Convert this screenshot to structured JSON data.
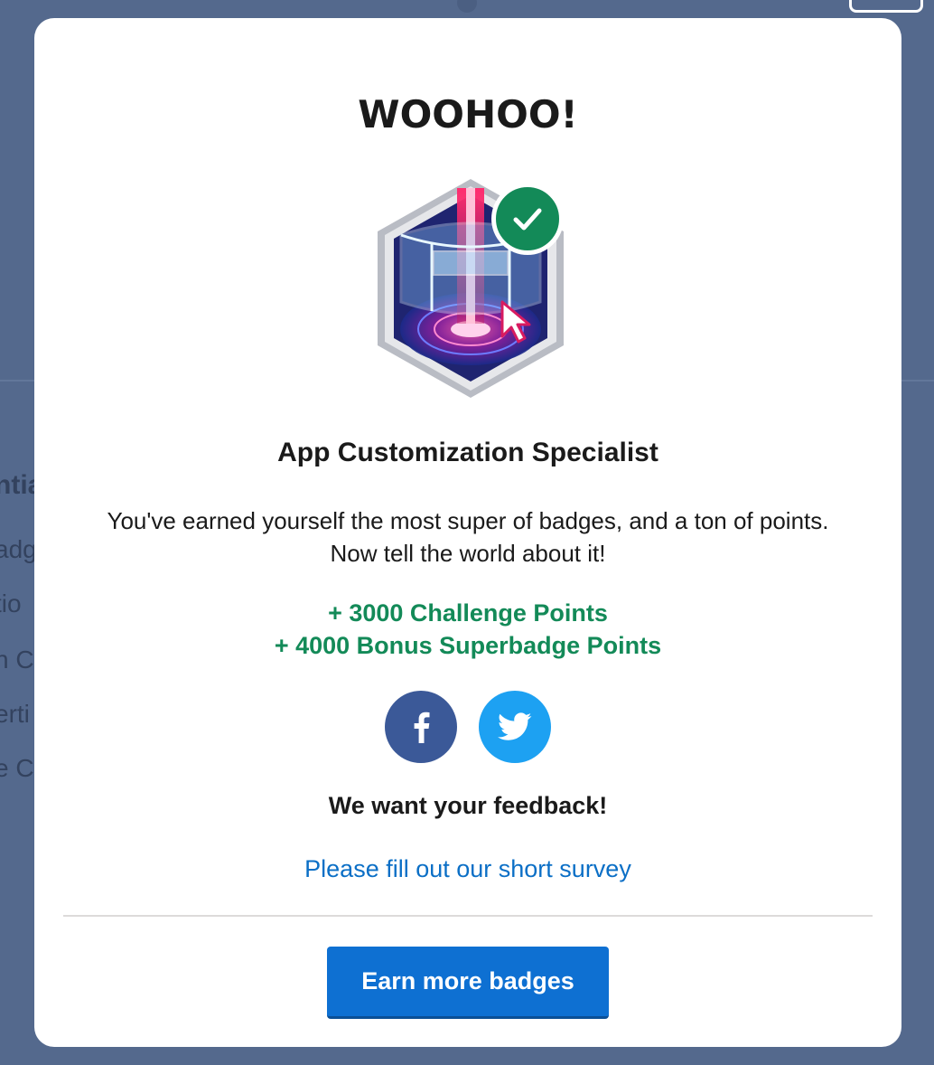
{
  "background": {
    "partial_heading": "ntia",
    "partial_items": [
      "adg",
      "tio",
      "n C",
      "erti",
      "e C"
    ]
  },
  "modal": {
    "title": "WOOHOO!",
    "badge_name": "App Customization Specialist",
    "message": "You've earned yourself the most super of badges, and a ton of points. Now tell the world about it!",
    "points": [
      "+ 3000 Challenge Points",
      "+ 4000 Bonus Superbadge Points"
    ],
    "feedback_heading": "We want your feedback!",
    "survey_link": "Please fill out our short survey",
    "cta_button": "Earn more badges"
  },
  "icons": {
    "badge": "superbadge-icon",
    "earned": "checkmark-icon",
    "share_facebook": "facebook-icon",
    "share_twitter": "twitter-icon"
  },
  "colors": {
    "points_green": "#138a58",
    "link_blue": "#0b6fc6",
    "button_blue": "#0e70d2",
    "facebook": "#3b5998",
    "twitter": "#1da1f2",
    "backdrop": "#54698d"
  }
}
